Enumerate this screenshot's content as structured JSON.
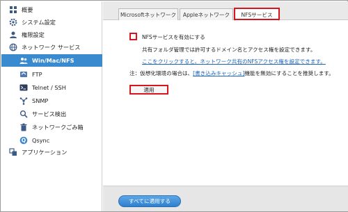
{
  "sidebar": {
    "items": [
      {
        "label": "概要",
        "icon": "overview-icon"
      },
      {
        "label": "システム設定",
        "icon": "gear-icon"
      },
      {
        "label": "権限設定",
        "icon": "user-icon"
      },
      {
        "label": "ネットワーク サービス",
        "icon": "globe-icon"
      },
      {
        "label": "Win/Mac/NFS",
        "icon": "people-icon"
      },
      {
        "label": "FTP",
        "icon": "ftp-icon"
      },
      {
        "label": "Telnet / SSH",
        "icon": "terminal-icon"
      },
      {
        "label": "SNMP",
        "icon": "snmp-icon"
      },
      {
        "label": "サービス検出",
        "icon": "search-icon"
      },
      {
        "label": "ネットワークごみ箱",
        "icon": "trash-icon"
      },
      {
        "label": "Qsync",
        "icon": "sync-icon"
      },
      {
        "label": "アプリケーション",
        "icon": "apps-icon"
      }
    ]
  },
  "tabs": [
    {
      "label": "Microsoftネットワーク"
    },
    {
      "label": "Appleネットワーク"
    },
    {
      "label": "NFSサービス"
    }
  ],
  "nfs": {
    "enable_label": "NFSサービスを有効にする",
    "line1": "共有フォルダ管理では許可するドメイン名とアクセス権を設定できます。",
    "link": "ここをクリックすると、ネットワーク共有のNFSアクセス権を設定できます。",
    "note_prefix": "注：仮想化環境の場合は、",
    "note_link": "[書き込みキャッシュ]",
    "note_suffix": "機能を無効にすることを推奨します。",
    "apply": "適用"
  },
  "footer": {
    "apply_all": "すべてに適用する"
  },
  "colors": {
    "accent": "#3a8ad0",
    "highlight": "#d8141c",
    "link": "#1b63b8"
  }
}
